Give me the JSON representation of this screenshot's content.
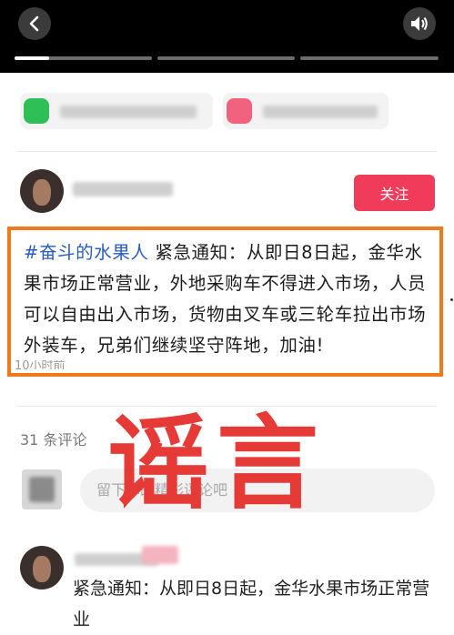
{
  "header": {
    "back_icon": "chevron-left-icon",
    "sound_icon": "speaker-icon",
    "progress": [
      0.25,
      0,
      0
    ]
  },
  "colors": {
    "accent": "#f13b5b",
    "hashtag": "#2a5bc0",
    "highlight_border": "#f0791e",
    "stamp": "#e53a36"
  },
  "post": {
    "follow_label": "关注",
    "hashtag": "#奋斗的水果人",
    "body": " 紧急通知：从即日8日起，金华水果市场正常营业，外地采购车不得进入市场，人员可以自由出入市场，货物由叉车或三轮车拉出市场外装车，兄弟们继续坚守阵地，加油!",
    "time": "10小时前"
  },
  "comments": {
    "count_label": "31 条评论",
    "input_placeholder": "留下你的精彩评论吧",
    "first_comment": "紧急通知：从即日8日起，金华水果市场正常营业"
  },
  "stamp_text": "谣言"
}
